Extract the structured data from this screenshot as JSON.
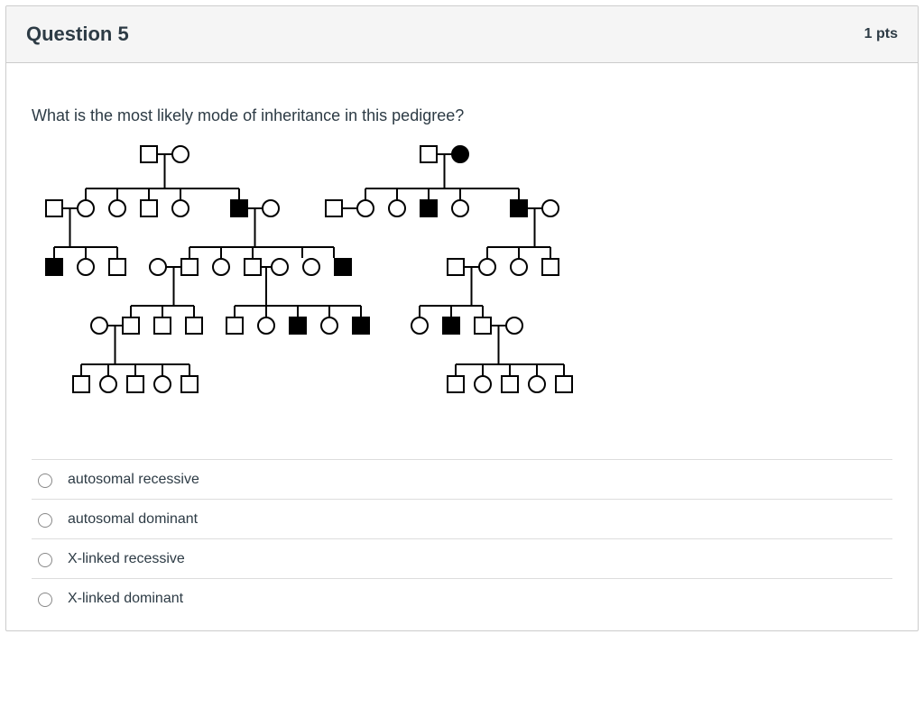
{
  "header": {
    "title": "Question 5",
    "points": "1 pts"
  },
  "question": {
    "text": "What is the most likely mode of inheritance in this pedigree?"
  },
  "answers": [
    {
      "label": "autosomal recessive"
    },
    {
      "label": "autosomal dominant"
    },
    {
      "label": "X-linked recessive"
    },
    {
      "label": "X-linked dominant"
    }
  ],
  "pedigree": {
    "description": "Two-family pedigree diagram spanning five rows. Squares = males, circles = females, filled = affected.",
    "gen1": [
      {
        "family": "left",
        "members": [
          {
            "sex": "M",
            "aff": false
          },
          {
            "sex": "F",
            "aff": false
          }
        ]
      },
      {
        "family": "right",
        "members": [
          {
            "sex": "M",
            "aff": false
          },
          {
            "sex": "F",
            "aff": true
          }
        ]
      }
    ],
    "gen2": {
      "left_spouse": {
        "sex": "M",
        "aff": false
      },
      "left_sibs": [
        {
          "sex": "F",
          "aff": false
        },
        {
          "sex": "F",
          "aff": false
        },
        {
          "sex": "M",
          "aff": false
        },
        {
          "sex": "F",
          "aff": false
        },
        {
          "sex": "M",
          "aff": true
        }
      ],
      "left_sib5_spouse": {
        "sex": "F",
        "aff": false
      },
      "right_sib1_spouse": {
        "sex": "M",
        "aff": false
      },
      "right_sibs": [
        {
          "sex": "F",
          "aff": false
        },
        {
          "sex": "F",
          "aff": false
        },
        {
          "sex": "M",
          "aff": true
        },
        {
          "sex": "F",
          "aff": false
        },
        {
          "sex": "M",
          "aff": true
        }
      ],
      "right_sib5_spouse": {
        "sex": "F",
        "aff": false
      }
    },
    "gen3": {
      "A": [
        {
          "sex": "M",
          "aff": true
        },
        {
          "sex": "F",
          "aff": false
        },
        {
          "sex": "M",
          "aff": false
        }
      ],
      "B_spouse": {
        "sex": "F",
        "aff": false
      },
      "B": [
        {
          "sex": "M",
          "aff": false
        },
        {
          "sex": "F",
          "aff": false
        },
        {
          "sex": "M",
          "aff": false
        }
      ],
      "B3_spouse": {
        "sex": "F",
        "aff": false
      },
      "B_extra": [
        {
          "sex": "F",
          "aff": false
        },
        {
          "sex": "M",
          "aff": true
        }
      ],
      "C_spouse": {
        "sex": "M",
        "aff": false
      },
      "C": [
        {
          "sex": "F",
          "aff": false
        },
        {
          "sex": "F",
          "aff": false
        },
        {
          "sex": "M",
          "aff": false
        }
      ]
    },
    "gen4": {
      "D_spouse": {
        "sex": "F",
        "aff": false
      },
      "D": [
        {
          "sex": "M",
          "aff": false
        },
        {
          "sex": "M",
          "aff": false
        },
        {
          "sex": "M",
          "aff": false
        }
      ],
      "E": [
        {
          "sex": "M",
          "aff": false
        },
        {
          "sex": "F",
          "aff": false
        },
        {
          "sex": "M",
          "aff": true
        },
        {
          "sex": "F",
          "aff": false
        },
        {
          "sex": "M",
          "aff": true
        }
      ],
      "F": [
        {
          "sex": "F",
          "aff": false
        },
        {
          "sex": "M",
          "aff": true
        },
        {
          "sex": "M",
          "aff": false
        }
      ],
      "F3_spouse": {
        "sex": "F",
        "aff": false
      }
    },
    "gen5": {
      "G": [
        {
          "sex": "M",
          "aff": false
        },
        {
          "sex": "F",
          "aff": false
        },
        {
          "sex": "M",
          "aff": false
        },
        {
          "sex": "F",
          "aff": false
        },
        {
          "sex": "M",
          "aff": false
        }
      ],
      "H": [
        {
          "sex": "M",
          "aff": false
        },
        {
          "sex": "F",
          "aff": false
        },
        {
          "sex": "M",
          "aff": false
        },
        {
          "sex": "F",
          "aff": false
        },
        {
          "sex": "M",
          "aff": false
        }
      ]
    }
  }
}
